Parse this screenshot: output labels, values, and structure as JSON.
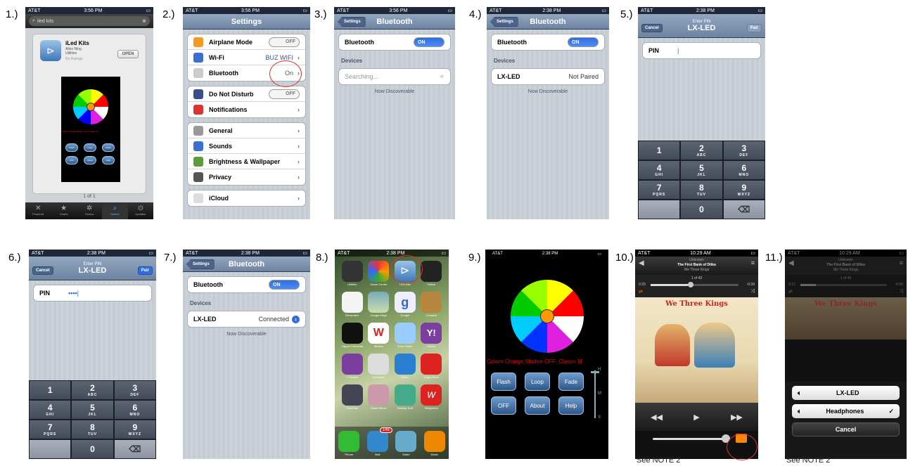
{
  "labels": [
    "1.)",
    "2.)",
    "3.)",
    "4.)",
    "5.)",
    "6.)",
    "7.)",
    "8.)",
    "9.)",
    "10.)",
    "11.)"
  ],
  "p1": {
    "carrier": "AT&T",
    "time": "3:56 PM",
    "search": "iled kits",
    "app_name": "iLed Kits",
    "app_dev": "Allen Ning",
    "app_cat": "Utilities",
    "app_rating": "No Ratings",
    "open": "OPEN",
    "page": "1 of 1",
    "colorline": "Color= Orange,Mode= Loop ,Class= N",
    "btns": [
      "Flash",
      "Loop",
      "Fade",
      "OFF",
      "About",
      "Help"
    ],
    "tabs": [
      "Featured",
      "Charts",
      "Genius",
      "Search",
      "Updates"
    ]
  },
  "p2": {
    "carrier": "AT&T",
    "time": "3:56 PM",
    "title": "Settings",
    "airplane": "Airplane Mode",
    "off": "OFF",
    "wifi": "Wi-Fi",
    "wifi_val": "BUZ WIFI",
    "bt": "Bluetooth",
    "bt_val": "On",
    "dnd": "Do Not Disturb",
    "notif": "Notifications",
    "general": "General",
    "sounds": "Sounds",
    "bright": "Brightness & Wallpaper",
    "privacy": "Privacy",
    "icloud": "iCloud"
  },
  "p3": {
    "carrier": "AT&T",
    "time": "3:56 PM",
    "back": "Settings",
    "title": "Bluetooth",
    "bt": "Bluetooth",
    "on": "ON",
    "devices": "Devices",
    "searching": "Searching...",
    "disc": "Now Discoverable"
  },
  "p4": {
    "carrier": "AT&T",
    "time": "2:38 PM",
    "back": "Settings",
    "title": "Bluetooth",
    "bt": "Bluetooth",
    "on": "ON",
    "devices": "Devices",
    "dev": "LX-LED",
    "status": "Not Paired",
    "disc": "Now Discoverable"
  },
  "p5": {
    "carrier": "AT&T",
    "time": "2:38 PM",
    "enter": "Enter PIN",
    "title": "LX-LED",
    "cancel": "Cancel",
    "pair": "Pair",
    "pin": "PIN",
    "pin_val": ""
  },
  "p6": {
    "carrier": "AT&T",
    "time": "2:38 PM",
    "enter": "Enter PIN",
    "title": "LX-LED",
    "cancel": "Cancel",
    "pair": "Pair",
    "pin": "PIN",
    "pin_val": "••••"
  },
  "keys": [
    [
      "1",
      ""
    ],
    [
      "2",
      "ABC"
    ],
    [
      "3",
      "DEF"
    ],
    [
      "4",
      "GHI"
    ],
    [
      "5",
      "JKL"
    ],
    [
      "6",
      "MNO"
    ],
    [
      "7",
      "PQRS"
    ],
    [
      "8",
      "TUV"
    ],
    [
      "9",
      "WXYZ"
    ],
    [
      "",
      ""
    ],
    [
      "0",
      ""
    ],
    [
      "⌫",
      ""
    ]
  ],
  "p7": {
    "carrier": "AT&T",
    "time": "2:38 PM",
    "back": "Settings",
    "title": "Bluetooth",
    "bt": "Bluetooth",
    "on": "ON",
    "devices": "Devices",
    "dev": "LX-LED",
    "status": "Connected",
    "disc": "Now Discoverable"
  },
  "p8": {
    "carrier": "AT&T",
    "time": "2:38 PM",
    "apps": [
      "Utilities",
      "Game Center",
      "LED-Kits",
      "Videos",
      "Reminders",
      "Google Maps",
      "Google",
      "Contacts",
      "Zapper Elements",
      "Wheelz",
      "Snow Globe",
      "Yahoo!",
      "Y! Search",
      "Dominoes",
      "Amex",
      "Angry Birds",
      "FaceDial",
      "Smart Mirror",
      "Subway Surf",
      "Walgreens"
    ],
    "dock": [
      "Phone",
      "Mail",
      "Safari",
      "Music"
    ],
    "badge": "149"
  },
  "p9": {
    "carrier": "AT&T",
    "time": "2:38 PM",
    "colorline": "Color= Orange,Mode= OFF ,Class= M",
    "btns": [
      "Flash",
      "Loop",
      "Fade",
      "OFF",
      "About",
      "Help"
    ],
    "scale": [
      "H",
      "M",
      "S"
    ]
  },
  "p10": {
    "carrier": "AT&T",
    "time": "10:29 AM",
    "artist": "Unknown",
    "track": "The First Bank of Ditka",
    "album": "We Three Kings",
    "count": "1 of 43",
    "elapsed": "0:29",
    "remain": "-0:39",
    "art_title": "We Three Kings",
    "caption": "See NOTE 2"
  },
  "p11": {
    "carrier": "AT&T",
    "time": "10:29 AM",
    "artist": "Unknown",
    "track": "The First Bank of Ditka",
    "album": "We Three Kings",
    "count": "1 of 43",
    "elapsed": "0:12",
    "remain": "-0:56",
    "art_title": "We Three Kings",
    "opt1": "LX-LED",
    "opt2": "Headphones",
    "check": "✓",
    "cancel": "Cancel",
    "caption": "See NOTE 2"
  },
  "footer": "See ... (cut)"
}
